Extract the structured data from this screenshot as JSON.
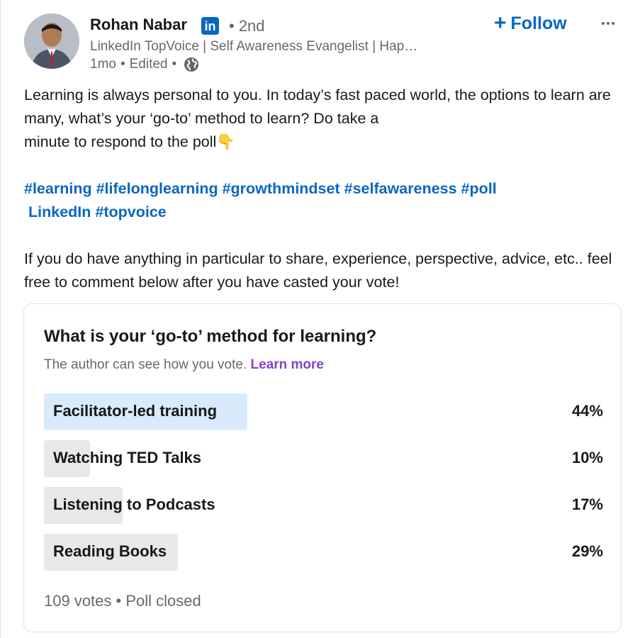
{
  "author": {
    "name": "Rohan Nabar",
    "badge": "in",
    "degree": "• 2nd",
    "headline": "LinkedIn TopVoice | Self Awareness Evangelist | Hap…",
    "time": "1mo",
    "edited": "Edited",
    "sep": "•",
    "visibility_icon": "globe-icon"
  },
  "actions": {
    "follow_label": "Follow",
    "follow_icon": "+",
    "more_icon": "more-horizontal-icon"
  },
  "post": {
    "paragraph1": "Learning is always personal to you. In today’s fast paced world, the options to learn are many, what’s your ‘go-to’ method to learn? Do take a",
    "paragraph1_line2": "minute to respond to the poll👇",
    "hashtags": [
      "#learning",
      "#lifelonglearning",
      "#growthmindset",
      "#selfawareness",
      "#poll"
    ],
    "mention": "LinkedIn",
    "hashtag_last": "#topvoice",
    "paragraph2": "If you do have anything in particular to share, experience, perspective, advice, etc.. feel free to comment below after you have casted your vote!"
  },
  "poll": {
    "question": "What is your ‘go-to’ method for learning?",
    "note": "The author can see how you vote.",
    "learn_more": "Learn more",
    "options": [
      {
        "label": "Facilitator-led training",
        "percent_text": "44%",
        "percent": 44,
        "leading": true
      },
      {
        "label": "Watching TED Talks",
        "percent_text": "10%",
        "percent": 10,
        "leading": false
      },
      {
        "label": "Listening to Podcasts",
        "percent_text": "17%",
        "percent": 17,
        "leading": false
      },
      {
        "label": "Reading Books",
        "percent_text": "29%",
        "percent": 29,
        "leading": false
      }
    ],
    "votes": "109 votes",
    "sep": "•",
    "status": "Poll closed"
  },
  "colors": {
    "brand": "#0a66c2",
    "learn_more": "#8344cc",
    "leading_bar": "#d9ebfb",
    "bar": "#e8e8e8"
  }
}
